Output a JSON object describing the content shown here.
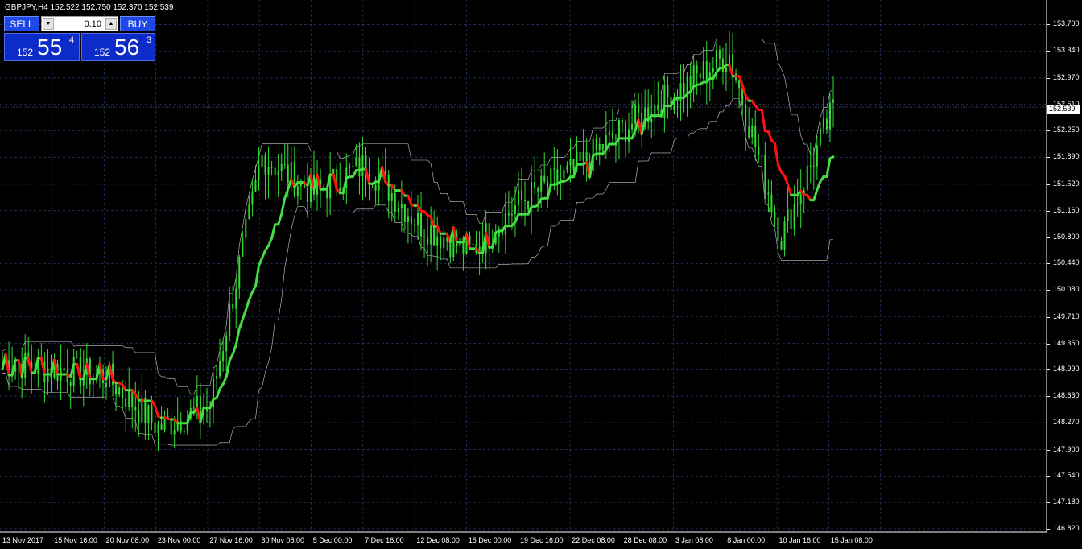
{
  "chart": {
    "symbol_info": "GBPJPY,H4  152.522 152.750 152.370 152.539",
    "colors": {
      "background": "#000000",
      "grid": "#2a3a6e",
      "candles": "#33dd33",
      "trend_up": "#44dd44",
      "trend_down": "#ff1111",
      "channel": "#c8c8c8",
      "axis": "#ffffff"
    }
  },
  "trade_panel": {
    "sell_label": "SELL",
    "buy_label": "BUY",
    "lot": "0.10",
    "sell_price": {
      "prefix": "152",
      "big": "55",
      "sup": "4"
    },
    "buy_price": {
      "prefix": "152",
      "big": "56",
      "sup": "3"
    }
  },
  "price_axis": {
    "labels": [
      "153.700",
      "153.340",
      "152.970",
      "152.610",
      "152.250",
      "151.890",
      "151.520",
      "151.160",
      "150.800",
      "150.440",
      "150.080",
      "149.710",
      "149.350",
      "148.990",
      "148.630",
      "148.270",
      "147.900",
      "147.540",
      "147.180",
      "146.820"
    ],
    "current_price": "152.539"
  },
  "time_axis": {
    "labels": [
      "13 Nov 2017",
      "15 Nov 16:00",
      "20 Nov 08:00",
      "23 Nov 00:00",
      "27 Nov 16:00",
      "30 Nov 08:00",
      "5 Dec 00:00",
      "7 Dec 16:00",
      "12 Dec 08:00",
      "15 Dec 00:00",
      "19 Dec 16:00",
      "22 Dec 08:00",
      "28 Dec 08:00",
      "3 Jan 08:00",
      "8 Jan 00:00",
      "10 Jan 16:00",
      "15 Jan 08:00"
    ]
  },
  "chart_data": {
    "type": "line",
    "title": "GBPJPY,H4",
    "ylim": [
      146.82,
      153.88
    ],
    "series": [
      {
        "name": "GBPJPY,H4",
        "x": [
          "13 Nov 2017",
          "15 Nov 16:00",
          "20 Nov 08:00",
          "23 Nov 00:00",
          "27 Nov 16:00",
          "30 Nov 08:00",
          "5 Dec 00:00",
          "7 Dec 16:00",
          "12 Dec 08:00",
          "15 Dec 00:00",
          "19 Dec 16:00",
          "22 Dec 08:00",
          "28 Dec 08:00",
          "3 Jan 08:00",
          "8 Jan 00:00",
          "10 Jan 16:00",
          "15 Jan 08:00"
        ],
        "values": [
          149.1,
          149.0,
          148.9,
          148.2,
          148.5,
          151.9,
          151.4,
          151.8,
          151.0,
          150.6,
          151.3,
          151.7,
          152.3,
          152.8,
          153.3,
          150.8,
          152.54
        ]
      }
    ]
  }
}
